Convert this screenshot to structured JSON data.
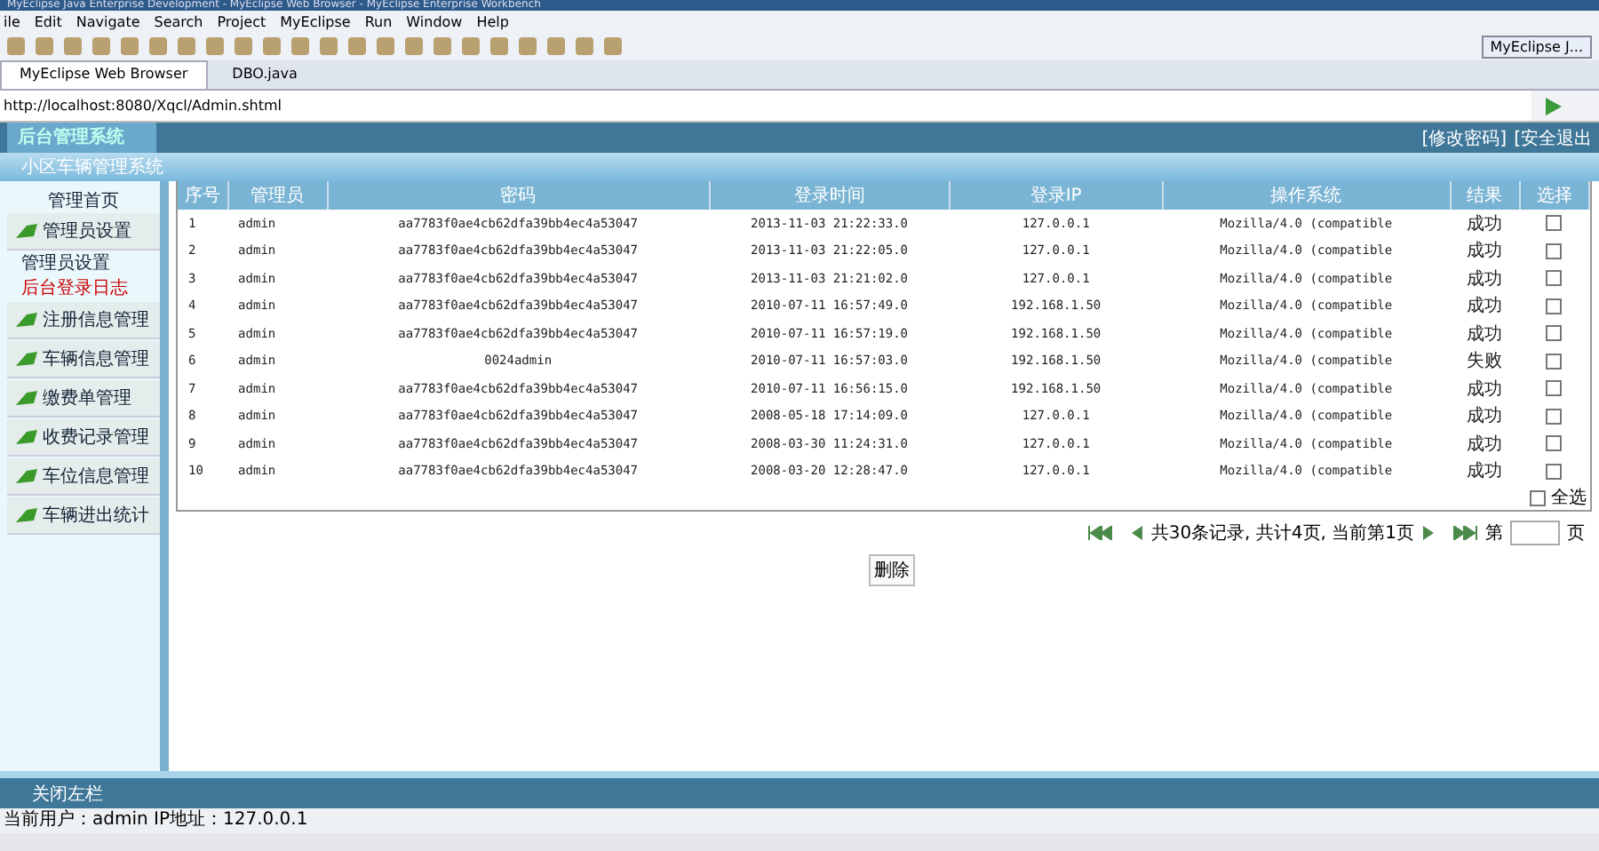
{
  "window": {
    "title": "MyEclipse Java Enterprise Development - MyEclipse Web Browser - MyEclipse Enterprise Workbench"
  },
  "menu": [
    "ile",
    "Edit",
    "Navigate",
    "Search",
    "Project",
    "MyEclipse",
    "Run",
    "Window",
    "Help"
  ],
  "perspective": {
    "label": "MyEclipse J..."
  },
  "editor_tabs": [
    {
      "label": "MyEclipse Web Browser",
      "selected": true
    },
    {
      "label": "DBO.java",
      "selected": false
    }
  ],
  "address": {
    "value": "http://localhost:8080/Xqcl/Admin.shtml"
  },
  "page": {
    "logo": "后台管理系统",
    "subtitle": "小区车辆管理系统",
    "top_links": [
      "[修改密码]",
      "[安全退出"
    ],
    "sidebar": [
      {
        "kind": "home",
        "label": "管理首页",
        "selected": false
      },
      {
        "kind": "group",
        "label": "管理员设置",
        "selected": false
      },
      {
        "kind": "sub",
        "label": "管理员设置",
        "selected": false
      },
      {
        "kind": "sub",
        "label": "后台登录日志",
        "selected": true
      },
      {
        "kind": "group",
        "label": "注册信息管理",
        "selected": false
      },
      {
        "kind": "group",
        "label": "车辆信息管理",
        "selected": false
      },
      {
        "kind": "group",
        "label": "缴费单管理",
        "selected": false
      },
      {
        "kind": "group",
        "label": "收费记录管理",
        "selected": false
      },
      {
        "kind": "group",
        "label": "车位信息管理",
        "selected": false
      },
      {
        "kind": "group",
        "label": "车辆进出统计",
        "selected": false
      }
    ],
    "table": {
      "columns": [
        "序号",
        "管理员",
        "密码",
        "登录时间",
        "登录IP",
        "操作系统",
        "结果",
        "选择"
      ],
      "rows": [
        {
          "cells": [
            "1",
            "admin",
            "aa7783f0ae4cb62dfa39bb4ec4a53047",
            "2013-11-03 21:22:33.0",
            "127.0.0.1",
            "Mozilla/4.0 (compatible",
            "成功"
          ],
          "checked": false
        },
        {
          "cells": [
            "2",
            "admin",
            "aa7783f0ae4cb62dfa39bb4ec4a53047",
            "2013-11-03 21:22:05.0",
            "127.0.0.1",
            "Mozilla/4.0 (compatible",
            "成功"
          ],
          "checked": false
        },
        {
          "cells": [
            "3",
            "admin",
            "aa7783f0ae4cb62dfa39bb4ec4a53047",
            "2013-11-03 21:21:02.0",
            "127.0.0.1",
            "Mozilla/4.0 (compatible",
            "成功"
          ],
          "checked": false
        },
        {
          "cells": [
            "4",
            "admin",
            "aa7783f0ae4cb62dfa39bb4ec4a53047",
            "2010-07-11 16:57:49.0",
            "192.168.1.50",
            "Mozilla/4.0 (compatible",
            "成功"
          ],
          "checked": false
        },
        {
          "cells": [
            "5",
            "admin",
            "aa7783f0ae4cb62dfa39bb4ec4a53047",
            "2010-07-11 16:57:19.0",
            "192.168.1.50",
            "Mozilla/4.0 (compatible",
            "成功"
          ],
          "checked": false
        },
        {
          "cells": [
            "6",
            "admin",
            "0024admin",
            "2010-07-11 16:57:03.0",
            "192.168.1.50",
            "Mozilla/4.0 (compatible",
            "失败"
          ],
          "checked": false
        },
        {
          "cells": [
            "7",
            "admin",
            "aa7783f0ae4cb62dfa39bb4ec4a53047",
            "2010-07-11 16:56:15.0",
            "192.168.1.50",
            "Mozilla/4.0 (compatible",
            "成功"
          ],
          "checked": false
        },
        {
          "cells": [
            "8",
            "admin",
            "aa7783f0ae4cb62dfa39bb4ec4a53047",
            "2008-05-18 17:14:09.0",
            "127.0.0.1",
            "Mozilla/4.0 (compatible",
            "成功"
          ],
          "checked": false
        },
        {
          "cells": [
            "9",
            "admin",
            "aa7783f0ae4cb62dfa39bb4ec4a53047",
            "2008-03-30 11:24:31.0",
            "127.0.0.1",
            "Mozilla/4.0 (compatible",
            "成功"
          ],
          "checked": false
        },
        {
          "cells": [
            "10",
            "admin",
            "aa7783f0ae4cb62dfa39bb4ec4a53047",
            "2008-03-20 12:28:47.0",
            "127.0.0.1",
            "Mozilla/4.0 (compatible",
            "成功"
          ],
          "checked": false
        }
      ],
      "select_all": {
        "label": "全选",
        "checked": false
      }
    },
    "pager": {
      "summary": "共30条记录, 共计4页, 当前第1页",
      "page_prefix": "第",
      "page_suffix": "页"
    },
    "delete_button": "删除",
    "footer": "关闭左栏",
    "status": "当前用户：admin  IP地址：127.0.0.1"
  }
}
